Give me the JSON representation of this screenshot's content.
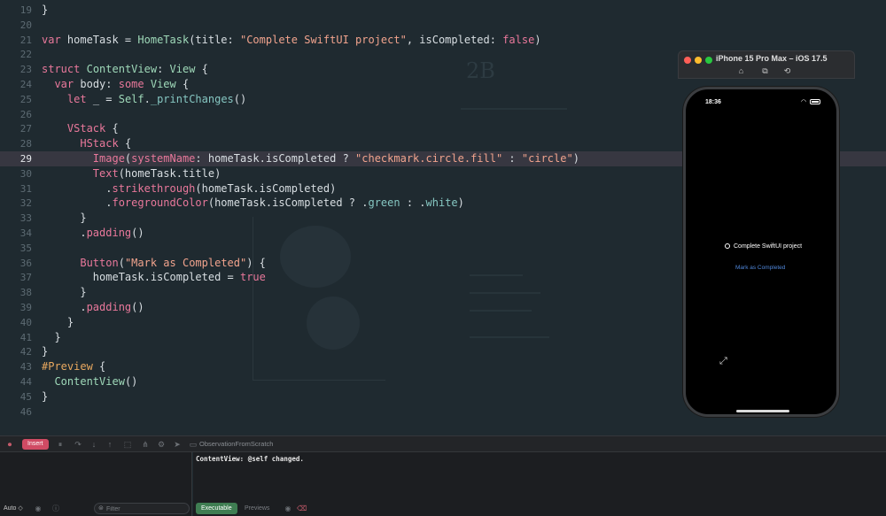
{
  "editor": {
    "lines": [
      {
        "num": "19",
        "tokens": [
          [
            "pl",
            "}"
          ]
        ]
      },
      {
        "num": "20",
        "tokens": []
      },
      {
        "num": "21",
        "tokens": [
          [
            "kw",
            "var"
          ],
          [
            "pl",
            " homeTask = "
          ],
          [
            "ty",
            "HomeTask"
          ],
          [
            "pl",
            "(title: "
          ],
          [
            "str",
            "\"Complete SwiftUI project\""
          ],
          [
            "pl",
            ", isCompleted: "
          ],
          [
            "kw",
            "false"
          ],
          [
            "pl",
            ")"
          ]
        ]
      },
      {
        "num": "22",
        "tokens": []
      },
      {
        "num": "23",
        "tokens": [
          [
            "kw",
            "struct"
          ],
          [
            "pl",
            " "
          ],
          [
            "ty",
            "ContentView"
          ],
          [
            "pl",
            ": "
          ],
          [
            "ty",
            "View"
          ],
          [
            "pl",
            " {"
          ]
        ]
      },
      {
        "num": "24",
        "tokens": [
          [
            "pl",
            "  "
          ],
          [
            "kw",
            "var"
          ],
          [
            "pl",
            " body: "
          ],
          [
            "kw",
            "some"
          ],
          [
            "pl",
            " "
          ],
          [
            "ty",
            "View"
          ],
          [
            "pl",
            " {"
          ]
        ]
      },
      {
        "num": "25",
        "tokens": [
          [
            "pl",
            "    "
          ],
          [
            "kw",
            "let"
          ],
          [
            "pl",
            " _ = "
          ],
          [
            "ty",
            "Self"
          ],
          [
            "pl",
            "."
          ],
          [
            "fn",
            "_printChanges"
          ],
          [
            "pl",
            "()"
          ]
        ]
      },
      {
        "num": "26",
        "tokens": []
      },
      {
        "num": "27",
        "tokens": [
          [
            "pl",
            "    "
          ],
          [
            "kw",
            "VStack"
          ],
          [
            "pl",
            " {"
          ]
        ]
      },
      {
        "num": "28",
        "tokens": [
          [
            "pl",
            "      "
          ],
          [
            "kw",
            "HStack"
          ],
          [
            "pl",
            " {"
          ]
        ]
      },
      {
        "num": "29",
        "tokens": [
          [
            "pl",
            "        "
          ],
          [
            "kw",
            "Image"
          ],
          [
            "pl",
            "("
          ],
          [
            "kw",
            "systemName"
          ],
          [
            "pl",
            ": homeTask.isCompleted ? "
          ],
          [
            "str",
            "\"checkmark.circle.fill\""
          ],
          [
            "pl",
            " : "
          ],
          [
            "str",
            "\"circle\""
          ],
          [
            "pl",
            ")"
          ]
        ]
      },
      {
        "num": "30",
        "tokens": [
          [
            "pl",
            "        "
          ],
          [
            "kw",
            "Text"
          ],
          [
            "pl",
            "(homeTask.title)"
          ]
        ]
      },
      {
        "num": "31",
        "tokens": [
          [
            "pl",
            "          ."
          ],
          [
            "kw",
            "strikethrough"
          ],
          [
            "pl",
            "(homeTask.isCompleted)"
          ]
        ]
      },
      {
        "num": "32",
        "tokens": [
          [
            "pl",
            "          ."
          ],
          [
            "kw",
            "foregroundColor"
          ],
          [
            "pl",
            "(homeTask.isCompleted ? ."
          ],
          [
            "fn",
            "green"
          ],
          [
            "pl",
            " : ."
          ],
          [
            "fn",
            "white"
          ],
          [
            "pl",
            ")"
          ]
        ]
      },
      {
        "num": "33",
        "tokens": [
          [
            "pl",
            "      }"
          ]
        ]
      },
      {
        "num": "34",
        "tokens": [
          [
            "pl",
            "      ."
          ],
          [
            "kw",
            "padding"
          ],
          [
            "pl",
            "()"
          ]
        ]
      },
      {
        "num": "35",
        "tokens": []
      },
      {
        "num": "36",
        "tokens": [
          [
            "pl",
            "      "
          ],
          [
            "kw",
            "Button"
          ],
          [
            "pl",
            "("
          ],
          [
            "str",
            "\"Mark as Completed\""
          ],
          [
            "pl",
            ") {"
          ]
        ]
      },
      {
        "num": "37",
        "tokens": [
          [
            "pl",
            "        homeTask.isCompleted = "
          ],
          [
            "kw",
            "true"
          ]
        ]
      },
      {
        "num": "38",
        "tokens": [
          [
            "pl",
            "      }"
          ]
        ]
      },
      {
        "num": "39",
        "tokens": [
          [
            "pl",
            "      ."
          ],
          [
            "kw",
            "padding"
          ],
          [
            "pl",
            "()"
          ]
        ]
      },
      {
        "num": "40",
        "tokens": [
          [
            "pl",
            "    }"
          ]
        ]
      },
      {
        "num": "41",
        "tokens": [
          [
            "pl",
            "  }"
          ]
        ]
      },
      {
        "num": "42",
        "tokens": [
          [
            "pl",
            "}"
          ]
        ]
      },
      {
        "num": "43",
        "tokens": [
          [
            "pp",
            "#Preview"
          ],
          [
            "pl",
            " {"
          ]
        ]
      },
      {
        "num": "44",
        "tokens": [
          [
            "pl",
            "  "
          ],
          [
            "ty",
            "ContentView"
          ],
          [
            "pl",
            "()"
          ]
        ]
      },
      {
        "num": "45",
        "tokens": [
          [
            "pl",
            "}"
          ]
        ]
      },
      {
        "num": "46",
        "tokens": []
      }
    ],
    "current_line": "29",
    "background_art_text": "2B"
  },
  "simulator": {
    "title": "iPhone 15 Pro Max – iOS 17.5",
    "traffic_colors": [
      "#ff5f57",
      "#febc2e",
      "#28c840"
    ],
    "toolbar_icons": [
      "home-icon",
      "screenshot-icon",
      "rotate-icon"
    ],
    "status": {
      "time": "18:36"
    },
    "app": {
      "task_title": "Complete SwiftUI project",
      "task_icon": "circle",
      "button_label": "Mark as Completed",
      "button_color": "#4f86d9"
    }
  },
  "debug_bar": {
    "mode_badge": "Insert",
    "scheme": "ObservationFromScratch"
  },
  "variables": {
    "scope": "Auto ◇",
    "filter_placeholder": "Filter"
  },
  "console": {
    "output": "ContentView: @self changed.",
    "tabs": [
      "Executable",
      "Previews"
    ]
  }
}
